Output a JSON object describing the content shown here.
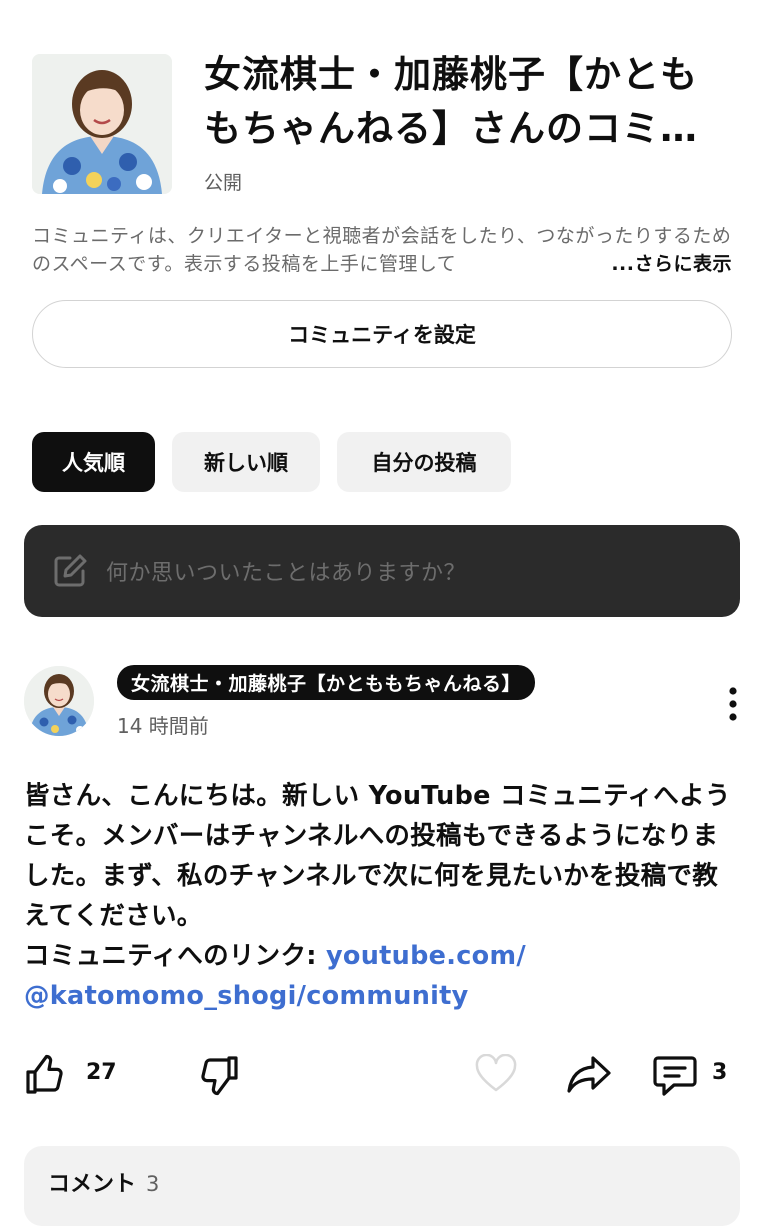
{
  "community": {
    "title": "女流棋士・加藤桃子【かとももちゃんねる】さんのコミュニティ",
    "visibility": "公開",
    "description": "コミュニティは、クリエイターと視聴者が会話をしたり、つながったりするためのスペースです。表示する投稿を上手に管理して",
    "more_label": "...さらに表示",
    "settings_button": "コミュニティを設定"
  },
  "filters": {
    "popular": "人気順",
    "newest": "新しい順",
    "mine": "自分の投稿",
    "selected": "人気順"
  },
  "composer": {
    "placeholder": "何か思いついたことはありますか？"
  },
  "post": {
    "author": "女流棋士・加藤桃子【かとももちゃんねる】",
    "time": "14 時間前",
    "body": "皆さん、こんにちは。新しい YouTube コミュニティへようこそ。メンバーはチャンネルへの投稿もできるようになりました。まず、私のチャンネルで次に何を見たいかを投稿で教えてください。",
    "link_prefix": "コミュニティへのリンク: ",
    "link_line1": "youtube.com/",
    "link_line2": "@katomomo_shogi/community",
    "likes": "27",
    "comment_count": "3"
  },
  "comments": {
    "label": "コメント",
    "count": "3"
  },
  "colors": {
    "link": "#3e6ed0",
    "composer_bg": "#2b2b2b",
    "chip_active": "#0f0f0f",
    "chip_inactive": "#f1f1f1"
  },
  "icons": [
    "edit-icon",
    "more-vert-icon",
    "thumb-up-icon",
    "thumb-down-icon",
    "heart-icon",
    "share-icon",
    "comment-icon"
  ]
}
